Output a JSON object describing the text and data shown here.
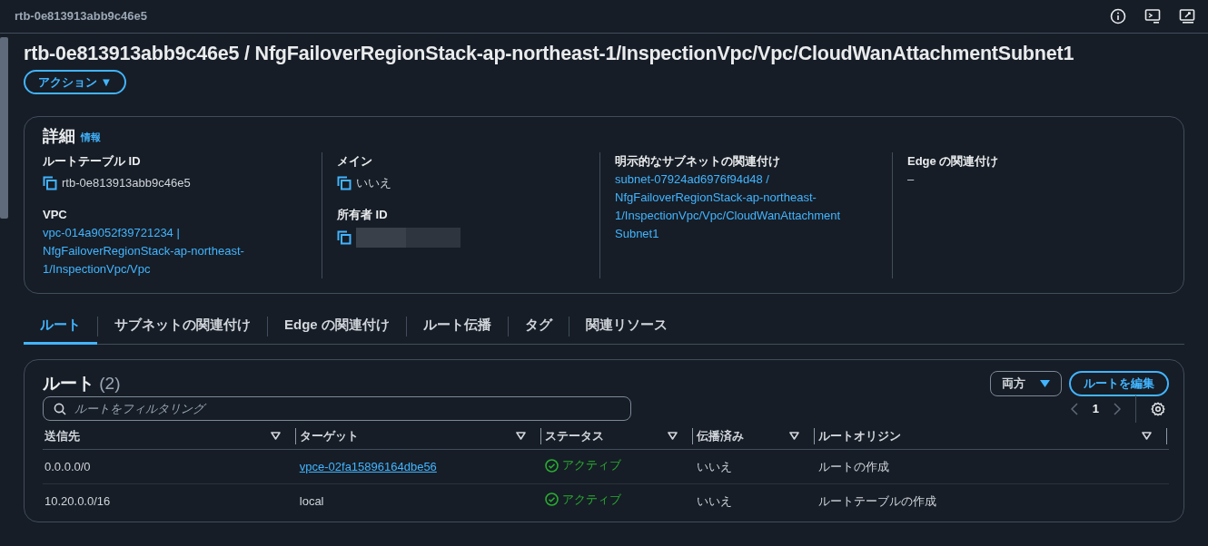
{
  "topbar": {
    "title": "rtb-0e813913abb9c46e5"
  },
  "page": {
    "title": "rtb-0e813913abb9c46e5 / NfgFailoverRegionStack-ap-northeast-1/InspectionVpc/Vpc/CloudWanAttachmentSubnet1",
    "actions_button": "アクション ▼"
  },
  "details": {
    "title": "詳細",
    "info_link": "情報",
    "columns": [
      [
        {
          "label": "ルートテーブル ID",
          "kind": "copy",
          "value": "rtb-0e813913abb9c46e5"
        },
        {
          "label": "VPC",
          "kind": "link",
          "value": "vpc-014a9052f39721234 | NfgFailoverRegionStack-ap-northeast-1/InspectionVpc/Vpc"
        }
      ],
      [
        {
          "label": "メイン",
          "kind": "copy",
          "value": "いいえ"
        },
        {
          "label": "所有者 ID",
          "kind": "redacted"
        }
      ],
      [
        {
          "label": "明示的なサブネットの関連付け",
          "kind": "link",
          "value": "subnet-07924ad6976f94d48 / NfgFailoverRegionStack-ap-northeast-1/InspectionVpc/Vpc/CloudWanAttachment Subnet1"
        }
      ],
      [
        {
          "label": "Edge の関連付け",
          "kind": "text",
          "value": "–"
        }
      ]
    ]
  },
  "tabs": [
    {
      "label": "ルート",
      "selected": true
    },
    {
      "label": "サブネットの関連付け",
      "selected": false
    },
    {
      "label": "Edge の関連付け",
      "selected": false
    },
    {
      "label": "ルート伝播",
      "selected": false
    },
    {
      "label": "タグ",
      "selected": false
    },
    {
      "label": "関連リソース",
      "selected": false
    }
  ],
  "routes": {
    "title": "ルート",
    "count": "(2)",
    "filter_button": "両方",
    "edit_button": "ルートを編集",
    "search": {
      "placeholder": "ルートをフィルタリング"
    },
    "page": "1",
    "columns": [
      "送信先",
      "ターゲット",
      "ステータス",
      "伝播済み",
      "ルートオリジン"
    ],
    "rows": [
      {
        "destination": "0.0.0.0/0",
        "target": {
          "kind": "link",
          "text": "vpce-02fa15896164dbe56"
        },
        "status": {
          "kind": "active",
          "text": "アクティブ"
        },
        "propagated": "いいえ",
        "origin": "ルートの作成"
      },
      {
        "destination": "10.20.0.0/16",
        "target": {
          "kind": "text",
          "text": "local"
        },
        "status": {
          "kind": "active",
          "text": "アクティブ"
        },
        "propagated": "いいえ",
        "origin": "ルートテーブルの作成"
      }
    ]
  }
}
